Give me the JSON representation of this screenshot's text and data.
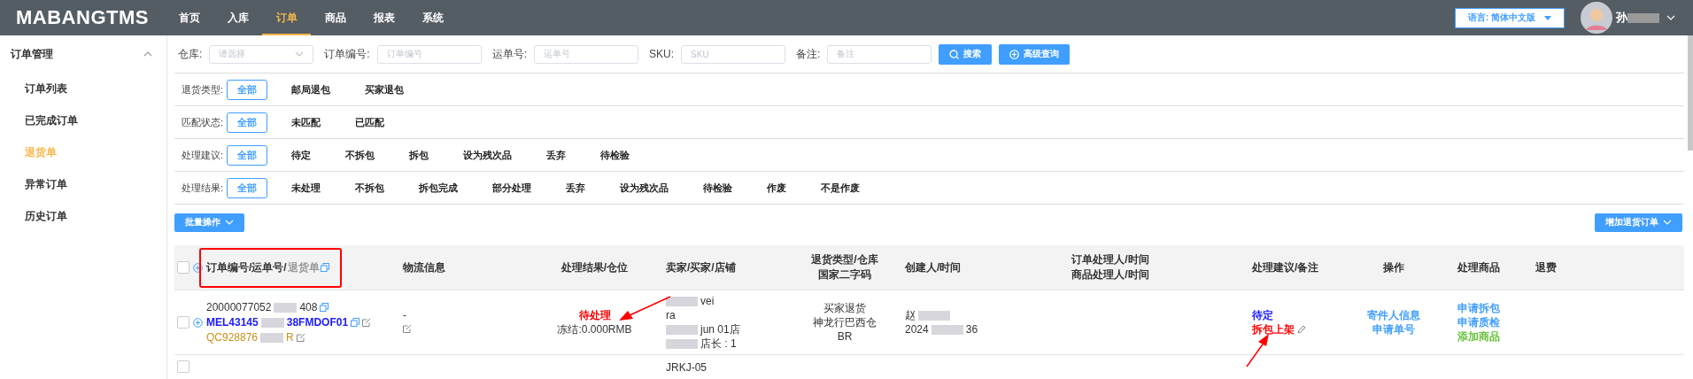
{
  "logo": "MABANGTMS",
  "nav": [
    {
      "label": "首页",
      "selected": false
    },
    {
      "label": "入库",
      "selected": false
    },
    {
      "label": "订单",
      "selected": true
    },
    {
      "label": "商品",
      "selected": false
    },
    {
      "label": "报表",
      "selected": false
    },
    {
      "label": "系统",
      "selected": false
    }
  ],
  "language": "语言: 简体中文版",
  "user": {
    "name": "孙"
  },
  "sidebar": {
    "title": "订单管理",
    "expanded": true,
    "items": [
      {
        "label": "订单列表",
        "selected": false
      },
      {
        "label": "已完成订单",
        "selected": false
      },
      {
        "label": "退货单",
        "selected": true
      },
      {
        "label": "异常订单",
        "selected": false
      },
      {
        "label": "历史订单",
        "selected": false
      }
    ]
  },
  "search": {
    "fields": [
      {
        "label": "仓库:",
        "placeholder": "请选择",
        "kind": "select"
      },
      {
        "label": "订单编号:",
        "placeholder": "订单编号",
        "kind": "input"
      },
      {
        "label": "运单号:",
        "placeholder": "运单号",
        "kind": "input"
      },
      {
        "label": "SKU:",
        "placeholder": "SKU",
        "kind": "input"
      },
      {
        "label": "备注:",
        "placeholder": "备注",
        "kind": "input"
      }
    ],
    "buttons": [
      "搜索",
      "高级查询"
    ]
  },
  "filters": [
    {
      "label": "退货类型:",
      "options": [
        {
          "label": "全部",
          "selected": true
        },
        {
          "label": "邮局退包",
          "selected": false
        },
        {
          "label": "买家退包",
          "selected": false
        }
      ]
    },
    {
      "label": "匹配状态:",
      "options": [
        {
          "label": "全部",
          "selected": true
        },
        {
          "label": "未匹配",
          "selected": false
        },
        {
          "label": "已匹配",
          "selected": false
        }
      ]
    },
    {
      "label": "处理建议:",
      "options": [
        {
          "label": "全部",
          "selected": true
        },
        {
          "label": "待定",
          "selected": false
        },
        {
          "label": "不拆包",
          "selected": false
        },
        {
          "label": "拆包",
          "selected": false
        },
        {
          "label": "设为残次品",
          "selected": false
        },
        {
          "label": "丢弃",
          "selected": false
        },
        {
          "label": "待检验",
          "selected": false
        }
      ]
    },
    {
      "label": "处理结果:",
      "options": [
        {
          "label": "全部",
          "selected": true
        },
        {
          "label": "未处理",
          "selected": false
        },
        {
          "label": "不拆包",
          "selected": false
        },
        {
          "label": "拆包完成",
          "selected": false
        },
        {
          "label": "部分处理",
          "selected": false
        },
        {
          "label": "丢弃",
          "selected": false
        },
        {
          "label": "设为残次品",
          "selected": false
        },
        {
          "label": "待检验",
          "selected": false
        },
        {
          "label": "作废",
          "selected": false
        },
        {
          "label": "不是作废",
          "selected": false
        }
      ]
    }
  ],
  "batch_button": "批量操作",
  "add_button": "增加退货订单",
  "table": {
    "all_checked": false,
    "columns": [
      {
        "label": "订单编号/运单号/",
        "extra": "退货单"
      },
      {
        "label": "物流信息"
      },
      {
        "label": "处理结果/仓位"
      },
      {
        "label": "卖家/买家/店铺"
      },
      {
        "lines": [
          "退货类型/仓库",
          "国家二字码"
        ]
      },
      {
        "label": "创建人/时间"
      },
      {
        "lines": [
          "订单处理人/时间",
          "商品处理人/时间"
        ]
      },
      {
        "label": "处理建议/备注"
      },
      {
        "label": "操作"
      },
      {
        "label": "处理商品"
      },
      {
        "label": "退费"
      }
    ],
    "rows": [
      {
        "checked": false,
        "order_no": [
          "20000077052",
          "408"
        ],
        "tracking_no": [
          "MEL43145",
          "38FMDOF01"
        ],
        "return_no": [
          "QC928876",
          "R"
        ],
        "logistics": "-",
        "result": "待处理",
        "frozen": "冻结:0.000RMB",
        "seller": [
          "vei",
          "ra",
          "jun 01店",
          "店长 : 1"
        ],
        "return_type": [
          "买家退货",
          "神龙行巴西仓",
          "BR"
        ],
        "creator": [
          "赵",
          "2024",
          "36"
        ],
        "suggestion": "待定",
        "remark": "拆包上架",
        "actions": [
          "寄件人信息",
          "申请单号"
        ],
        "goods_actions": [
          {
            "label": "申请拆包",
            "kind": "link"
          },
          {
            "label": "申请质检",
            "kind": "link"
          },
          {
            "label": "添加商品",
            "kind": "add"
          }
        ]
      },
      {
        "checked": false,
        "seller": [
          "JRKJ-05"
        ]
      }
    ]
  }
}
